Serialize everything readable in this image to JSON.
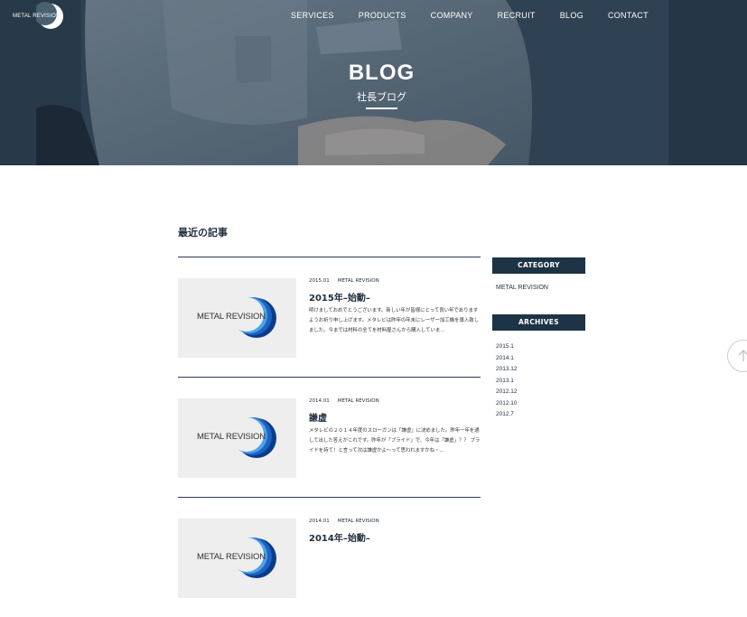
{
  "header": {
    "logo_text": "METAL REVISION",
    "nav": [
      "SERVICES",
      "PRODUCTS",
      "COMPANY",
      "RECRUIT",
      "BLOG",
      "CONTACT"
    ]
  },
  "hero": {
    "title": "BLOG",
    "subtitle": "社長ブログ"
  },
  "main": {
    "section_title": "最近の記事",
    "posts": [
      {
        "thumb_text": "METAL REVISION",
        "date": "2015.01",
        "category": "METAL REVISION",
        "title": "2015年–始動–",
        "excerpt": "明けましておめでとうございます。新しい年が皆様にとって良い年でありますようお祈り申し上げます。メタレビは昨年の年末にレーザー加工機を導入致しました。今までは材料の全てを材料屋さんから購入していま..."
      },
      {
        "thumb_text": "METAL REVISION",
        "date": "2014.01",
        "category": "METAL REVISION",
        "title": "謙虚",
        "excerpt": "メタレビの２０１４年度のスローガンは「謙虚」に決めました。昨年一年を通して出した答えがこれです。昨年が「プライド」で、今年は「謙虚」？？ プライドを持て！と言って次は謙虚かよ〜って思われますかね・..."
      },
      {
        "thumb_text": "METAL REVISION",
        "date": "2014.01",
        "category": "METAL REVISION",
        "title": "2014年–始動–",
        "excerpt": ""
      }
    ]
  },
  "sidebar": {
    "category_heading": "CATEGORY",
    "category_link": "METAL REVISION",
    "archives_heading": "ARCHIVES",
    "archives": [
      "2015.1",
      "2014.1",
      "2013.12",
      "2013.1",
      "2012.12",
      "2012.10",
      "2012.7"
    ]
  },
  "colors": {
    "accent_navy": "#1d3346",
    "logo_blue": "#1e63c4",
    "text": "#1f2d3d"
  },
  "icons": {
    "logo_mark": "crescent-moon-icon",
    "page_top": "arrow-up-icon"
  }
}
